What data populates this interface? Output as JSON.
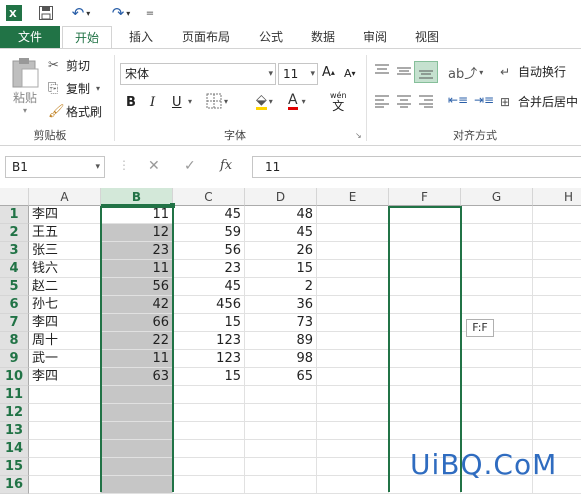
{
  "qat": {
    "excel_icon": "excel-icon",
    "save_icon": "save-icon",
    "undo_icon": "undo-icon",
    "redo_icon": "redo-icon",
    "more": "="
  },
  "tabs": [
    {
      "label": "文件",
      "active": false,
      "file": true
    },
    {
      "label": "开始",
      "active": true,
      "file": false
    },
    {
      "label": "插入",
      "active": false,
      "file": false
    },
    {
      "label": "页面布局",
      "active": false,
      "file": false
    },
    {
      "label": "公式",
      "active": false,
      "file": false
    },
    {
      "label": "数据",
      "active": false,
      "file": false
    },
    {
      "label": "审阅",
      "active": false,
      "file": false
    },
    {
      "label": "视图",
      "active": false,
      "file": false
    }
  ],
  "clipboard": {
    "paste": "粘贴",
    "cut": "剪切",
    "copy": "复制",
    "format_painter": "格式刷",
    "group": "剪贴板"
  },
  "font": {
    "name": "宋体",
    "size": "11",
    "bold": "B",
    "italic": "I",
    "underline": "U",
    "wen": "wén",
    "group": "字体"
  },
  "alignment": {
    "wrap": "自动换行",
    "merge": "合并后居中",
    "group": "对齐方式"
  },
  "formula_bar": {
    "name_box": "B1",
    "value": "11",
    "fx": "fx"
  },
  "columns": [
    "A",
    "B",
    "C",
    "D",
    "E",
    "F",
    "G",
    "H"
  ],
  "rows": [
    {
      "n": "1",
      "a": "李四",
      "b": "11",
      "c": "45",
      "d": "48"
    },
    {
      "n": "2",
      "a": "王五",
      "b": "12",
      "c": "59",
      "d": "45"
    },
    {
      "n": "3",
      "a": "张三",
      "b": "23",
      "c": "56",
      "d": "26"
    },
    {
      "n": "4",
      "a": "钱六",
      "b": "11",
      "c": "23",
      "d": "15"
    },
    {
      "n": "5",
      "a": "赵二",
      "b": "56",
      "c": "45",
      "d": "2"
    },
    {
      "n": "6",
      "a": "孙七",
      "b": "42",
      "c": "456",
      "d": "36"
    },
    {
      "n": "7",
      "a": "李四",
      "b": "66",
      "c": "15",
      "d": "73"
    },
    {
      "n": "8",
      "a": "周十",
      "b": "22",
      "c": "123",
      "d": "89"
    },
    {
      "n": "9",
      "a": "武一",
      "b": "11",
      "c": "123",
      "d": "98"
    },
    {
      "n": "10",
      "a": "李四",
      "b": "63",
      "c": "15",
      "d": "65"
    },
    {
      "n": "11",
      "a": "",
      "b": "",
      "c": "",
      "d": ""
    },
    {
      "n": "12",
      "a": "",
      "b": "",
      "c": "",
      "d": ""
    },
    {
      "n": "13",
      "a": "",
      "b": "",
      "c": "",
      "d": ""
    },
    {
      "n": "14",
      "a": "",
      "b": "",
      "c": "",
      "d": ""
    },
    {
      "n": "15",
      "a": "",
      "b": "",
      "c": "",
      "d": ""
    },
    {
      "n": "16",
      "a": "",
      "b": "",
      "c": "",
      "d": ""
    }
  ],
  "tooltip": "F:F",
  "watermark": "UiBQ.CoM",
  "colors": {
    "accent": "#217346",
    "selection": "#c6c6c6",
    "watermark": "#2f6cc0"
  }
}
